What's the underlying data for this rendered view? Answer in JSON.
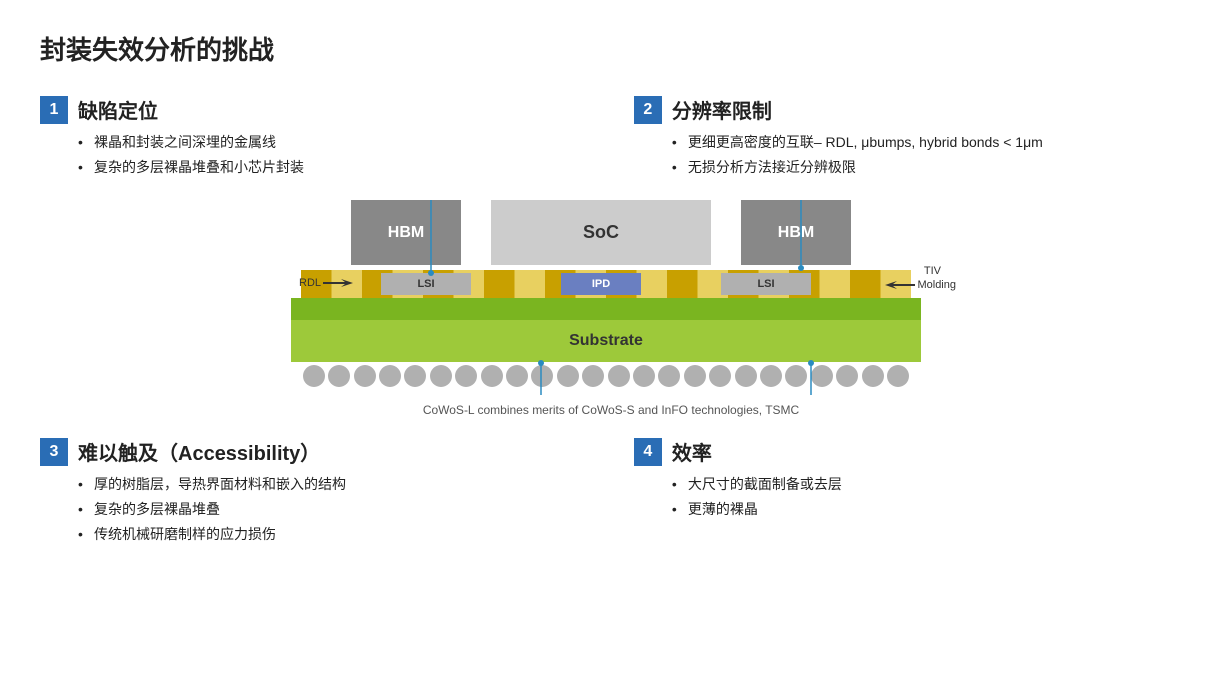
{
  "title": "封装失效分析的挑战",
  "sections": {
    "s1": {
      "number": "1",
      "title": "缺陷定位",
      "bullets": [
        "裸晶和封装之间深埋的金属线",
        "复杂的多层裸晶堆叠和小芯片封装"
      ]
    },
    "s2": {
      "number": "2",
      "title": "分辨率限制",
      "bullets": [
        "更细更高密度的互联– RDL, μbumps, hybrid bonds < 1μm",
        "无损分析方法接近分辨极限"
      ]
    },
    "s3": {
      "number": "3",
      "title": "难以触及（Accessibility）",
      "bullets": [
        "厚的树脂层，导热界面材料和嵌入的结构",
        "复杂的多层裸晶堆叠",
        "传统机械研磨制样的应力损伤"
      ]
    },
    "s4": {
      "number": "4",
      "title": "效率",
      "bullets": [
        "大尺寸的截面制备或去层",
        "更薄的裸晶"
      ]
    }
  },
  "diagram": {
    "hbm_left": "HBM",
    "soc": "SoC",
    "hbm_right": "HBM",
    "lsi_left": "LSI",
    "ipd": "IPD",
    "lsi_right": "LSI",
    "substrate": "Substrate",
    "rdl_label": "RDL",
    "tiv_label": "TIV",
    "molding_label": "Molding",
    "caption": "CoWoS-L combines merits of CoWoS-S and InFO technologies, TSMC"
  }
}
